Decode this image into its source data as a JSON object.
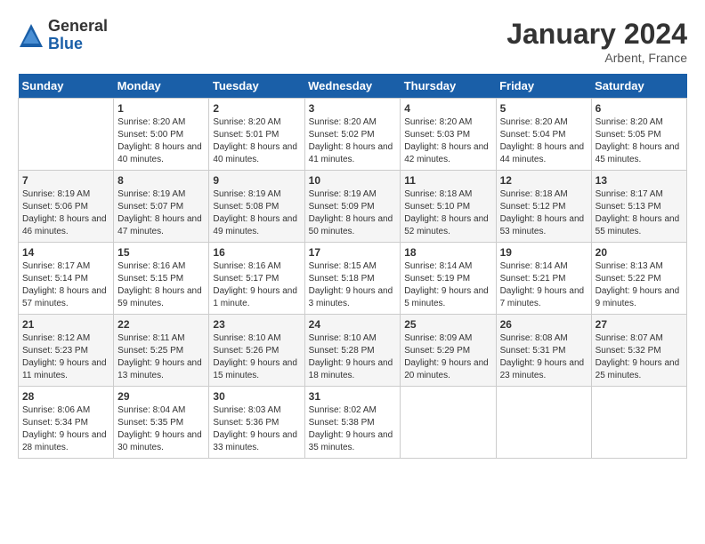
{
  "header": {
    "logo_general": "General",
    "logo_blue": "Blue",
    "month_title": "January 2024",
    "location": "Arbent, France"
  },
  "days_of_week": [
    "Sunday",
    "Monday",
    "Tuesday",
    "Wednesday",
    "Thursday",
    "Friday",
    "Saturday"
  ],
  "weeks": [
    [
      {
        "day": "",
        "sunrise": "",
        "sunset": "",
        "daylight": ""
      },
      {
        "day": "1",
        "sunrise": "Sunrise: 8:20 AM",
        "sunset": "Sunset: 5:00 PM",
        "daylight": "Daylight: 8 hours and 40 minutes."
      },
      {
        "day": "2",
        "sunrise": "Sunrise: 8:20 AM",
        "sunset": "Sunset: 5:01 PM",
        "daylight": "Daylight: 8 hours and 40 minutes."
      },
      {
        "day": "3",
        "sunrise": "Sunrise: 8:20 AM",
        "sunset": "Sunset: 5:02 PM",
        "daylight": "Daylight: 8 hours and 41 minutes."
      },
      {
        "day": "4",
        "sunrise": "Sunrise: 8:20 AM",
        "sunset": "Sunset: 5:03 PM",
        "daylight": "Daylight: 8 hours and 42 minutes."
      },
      {
        "day": "5",
        "sunrise": "Sunrise: 8:20 AM",
        "sunset": "Sunset: 5:04 PM",
        "daylight": "Daylight: 8 hours and 44 minutes."
      },
      {
        "day": "6",
        "sunrise": "Sunrise: 8:20 AM",
        "sunset": "Sunset: 5:05 PM",
        "daylight": "Daylight: 8 hours and 45 minutes."
      }
    ],
    [
      {
        "day": "7",
        "sunrise": "Sunrise: 8:19 AM",
        "sunset": "Sunset: 5:06 PM",
        "daylight": "Daylight: 8 hours and 46 minutes."
      },
      {
        "day": "8",
        "sunrise": "Sunrise: 8:19 AM",
        "sunset": "Sunset: 5:07 PM",
        "daylight": "Daylight: 8 hours and 47 minutes."
      },
      {
        "day": "9",
        "sunrise": "Sunrise: 8:19 AM",
        "sunset": "Sunset: 5:08 PM",
        "daylight": "Daylight: 8 hours and 49 minutes."
      },
      {
        "day": "10",
        "sunrise": "Sunrise: 8:19 AM",
        "sunset": "Sunset: 5:09 PM",
        "daylight": "Daylight: 8 hours and 50 minutes."
      },
      {
        "day": "11",
        "sunrise": "Sunrise: 8:18 AM",
        "sunset": "Sunset: 5:10 PM",
        "daylight": "Daylight: 8 hours and 52 minutes."
      },
      {
        "day": "12",
        "sunrise": "Sunrise: 8:18 AM",
        "sunset": "Sunset: 5:12 PM",
        "daylight": "Daylight: 8 hours and 53 minutes."
      },
      {
        "day": "13",
        "sunrise": "Sunrise: 8:17 AM",
        "sunset": "Sunset: 5:13 PM",
        "daylight": "Daylight: 8 hours and 55 minutes."
      }
    ],
    [
      {
        "day": "14",
        "sunrise": "Sunrise: 8:17 AM",
        "sunset": "Sunset: 5:14 PM",
        "daylight": "Daylight: 8 hours and 57 minutes."
      },
      {
        "day": "15",
        "sunrise": "Sunrise: 8:16 AM",
        "sunset": "Sunset: 5:15 PM",
        "daylight": "Daylight: 8 hours and 59 minutes."
      },
      {
        "day": "16",
        "sunrise": "Sunrise: 8:16 AM",
        "sunset": "Sunset: 5:17 PM",
        "daylight": "Daylight: 9 hours and 1 minute."
      },
      {
        "day": "17",
        "sunrise": "Sunrise: 8:15 AM",
        "sunset": "Sunset: 5:18 PM",
        "daylight": "Daylight: 9 hours and 3 minutes."
      },
      {
        "day": "18",
        "sunrise": "Sunrise: 8:14 AM",
        "sunset": "Sunset: 5:19 PM",
        "daylight": "Daylight: 9 hours and 5 minutes."
      },
      {
        "day": "19",
        "sunrise": "Sunrise: 8:14 AM",
        "sunset": "Sunset: 5:21 PM",
        "daylight": "Daylight: 9 hours and 7 minutes."
      },
      {
        "day": "20",
        "sunrise": "Sunrise: 8:13 AM",
        "sunset": "Sunset: 5:22 PM",
        "daylight": "Daylight: 9 hours and 9 minutes."
      }
    ],
    [
      {
        "day": "21",
        "sunrise": "Sunrise: 8:12 AM",
        "sunset": "Sunset: 5:23 PM",
        "daylight": "Daylight: 9 hours and 11 minutes."
      },
      {
        "day": "22",
        "sunrise": "Sunrise: 8:11 AM",
        "sunset": "Sunset: 5:25 PM",
        "daylight": "Daylight: 9 hours and 13 minutes."
      },
      {
        "day": "23",
        "sunrise": "Sunrise: 8:10 AM",
        "sunset": "Sunset: 5:26 PM",
        "daylight": "Daylight: 9 hours and 15 minutes."
      },
      {
        "day": "24",
        "sunrise": "Sunrise: 8:10 AM",
        "sunset": "Sunset: 5:28 PM",
        "daylight": "Daylight: 9 hours and 18 minutes."
      },
      {
        "day": "25",
        "sunrise": "Sunrise: 8:09 AM",
        "sunset": "Sunset: 5:29 PM",
        "daylight": "Daylight: 9 hours and 20 minutes."
      },
      {
        "day": "26",
        "sunrise": "Sunrise: 8:08 AM",
        "sunset": "Sunset: 5:31 PM",
        "daylight": "Daylight: 9 hours and 23 minutes."
      },
      {
        "day": "27",
        "sunrise": "Sunrise: 8:07 AM",
        "sunset": "Sunset: 5:32 PM",
        "daylight": "Daylight: 9 hours and 25 minutes."
      }
    ],
    [
      {
        "day": "28",
        "sunrise": "Sunrise: 8:06 AM",
        "sunset": "Sunset: 5:34 PM",
        "daylight": "Daylight: 9 hours and 28 minutes."
      },
      {
        "day": "29",
        "sunrise": "Sunrise: 8:04 AM",
        "sunset": "Sunset: 5:35 PM",
        "daylight": "Daylight: 9 hours and 30 minutes."
      },
      {
        "day": "30",
        "sunrise": "Sunrise: 8:03 AM",
        "sunset": "Sunset: 5:36 PM",
        "daylight": "Daylight: 9 hours and 33 minutes."
      },
      {
        "day": "31",
        "sunrise": "Sunrise: 8:02 AM",
        "sunset": "Sunset: 5:38 PM",
        "daylight": "Daylight: 9 hours and 35 minutes."
      },
      {
        "day": "",
        "sunrise": "",
        "sunset": "",
        "daylight": ""
      },
      {
        "day": "",
        "sunrise": "",
        "sunset": "",
        "daylight": ""
      },
      {
        "day": "",
        "sunrise": "",
        "sunset": "",
        "daylight": ""
      }
    ]
  ]
}
